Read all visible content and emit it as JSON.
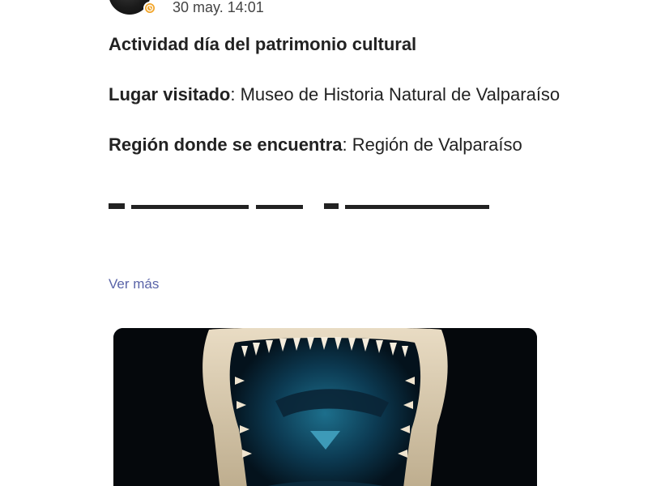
{
  "post": {
    "timestamp": "30 may. 14:01",
    "title": "Actividad día del patrimonio cultural",
    "fields": [
      {
        "label": "Lugar visitado",
        "separator": ": ",
        "value": "Museo de Historia Natural de Valparaíso"
      },
      {
        "label": "Región donde se encuentra",
        "separator": ": ",
        "value": "Región de Valparaíso"
      }
    ],
    "see_more_label": "Ver más"
  },
  "avatar": {
    "icon": "user-avatar",
    "badge_icon": "clock-badge-icon",
    "badge_color": "#f2a52a"
  },
  "colors": {
    "link": "#5a64a8",
    "text": "#222222",
    "photo_background": "#05080c"
  }
}
